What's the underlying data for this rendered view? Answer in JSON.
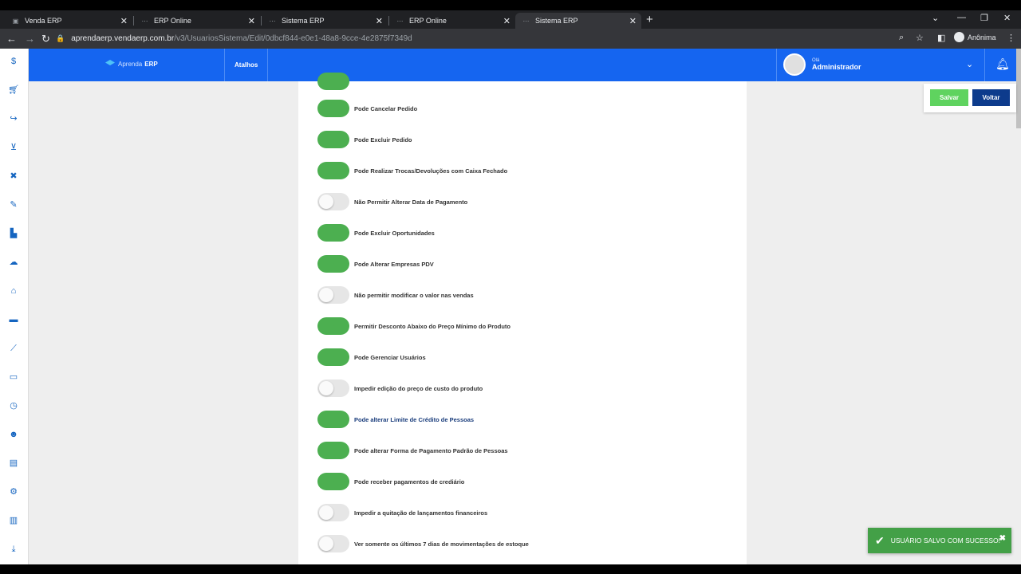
{
  "browser": {
    "tabs": [
      {
        "title": "Venda ERP",
        "active": false
      },
      {
        "title": "ERP Online",
        "active": false
      },
      {
        "title": "Sistema ERP",
        "active": false
      },
      {
        "title": "ERP Online",
        "active": false
      },
      {
        "title": "Sistema ERP",
        "active": true
      }
    ],
    "url_host": "aprendaerp.vendaerp.com.br",
    "url_path": "/v3/UsuariosSistema/Edit/0dbcf844-e0e1-48a8-9cce-4e2875f7349d",
    "profile_label": "Anônima"
  },
  "header": {
    "logo_text": "Aprenda",
    "logo_bold": "ERP",
    "shortcuts_label": "Atalhos",
    "greeting": "Olá",
    "user_name": "Administrador"
  },
  "actions": {
    "save_label": "Salvar",
    "back_label": "Voltar"
  },
  "sidebar_icons": [
    "dollar-icon",
    "cart-icon",
    "share-icon",
    "cart-check-icon",
    "tools-icon",
    "edit-icon",
    "hierarchy-icon",
    "cloud-icon",
    "bank-icon",
    "car-icon",
    "wrench-icon",
    "monitor-icon",
    "clock-icon",
    "users-icon",
    "report-icon",
    "gear-icon",
    "chart-icon",
    "download-icon"
  ],
  "permissions": [
    {
      "label": "Pode Cancelar Pedido",
      "enabled": true
    },
    {
      "label": "Pode Excluir Pedido",
      "enabled": true
    },
    {
      "label": "Pode Realizar Trocas/Devoluções com Caixa Fechado",
      "enabled": true
    },
    {
      "label": "Não Permitir Alterar Data de Pagamento",
      "enabled": false
    },
    {
      "label": "Pode Excluir Oportunidades",
      "enabled": true
    },
    {
      "label": "Pode Alterar Empresas PDV",
      "enabled": true
    },
    {
      "label": "Não permitir modificar o valor nas vendas",
      "enabled": false
    },
    {
      "label": "Permitir Desconto Abaixo do Preço Mínimo do Produto",
      "enabled": true
    },
    {
      "label": "Pode Gerenciar Usuários",
      "enabled": true
    },
    {
      "label": "Impedir edição do preço de custo do produto",
      "enabled": false
    },
    {
      "label": "Pode alterar Limite de Crédito de Pessoas",
      "enabled": true
    },
    {
      "label": "Pode alterar Forma de Pagamento Padrão de Pessoas",
      "enabled": true
    },
    {
      "label": "Pode receber pagamentos de crediário",
      "enabled": true
    },
    {
      "label": "Impedir a quitação de lançamentos financeiros",
      "enabled": false
    },
    {
      "label": "Ver somente os últimos 7 dias de movimentações de estoque",
      "enabled": false
    }
  ],
  "toast": {
    "message": "USUÁRIO SALVO COM SUCESSO!"
  },
  "colors": {
    "brand_blue": "#1565f0",
    "toggle_on": "#4caf50",
    "toast_green": "#43a047"
  }
}
